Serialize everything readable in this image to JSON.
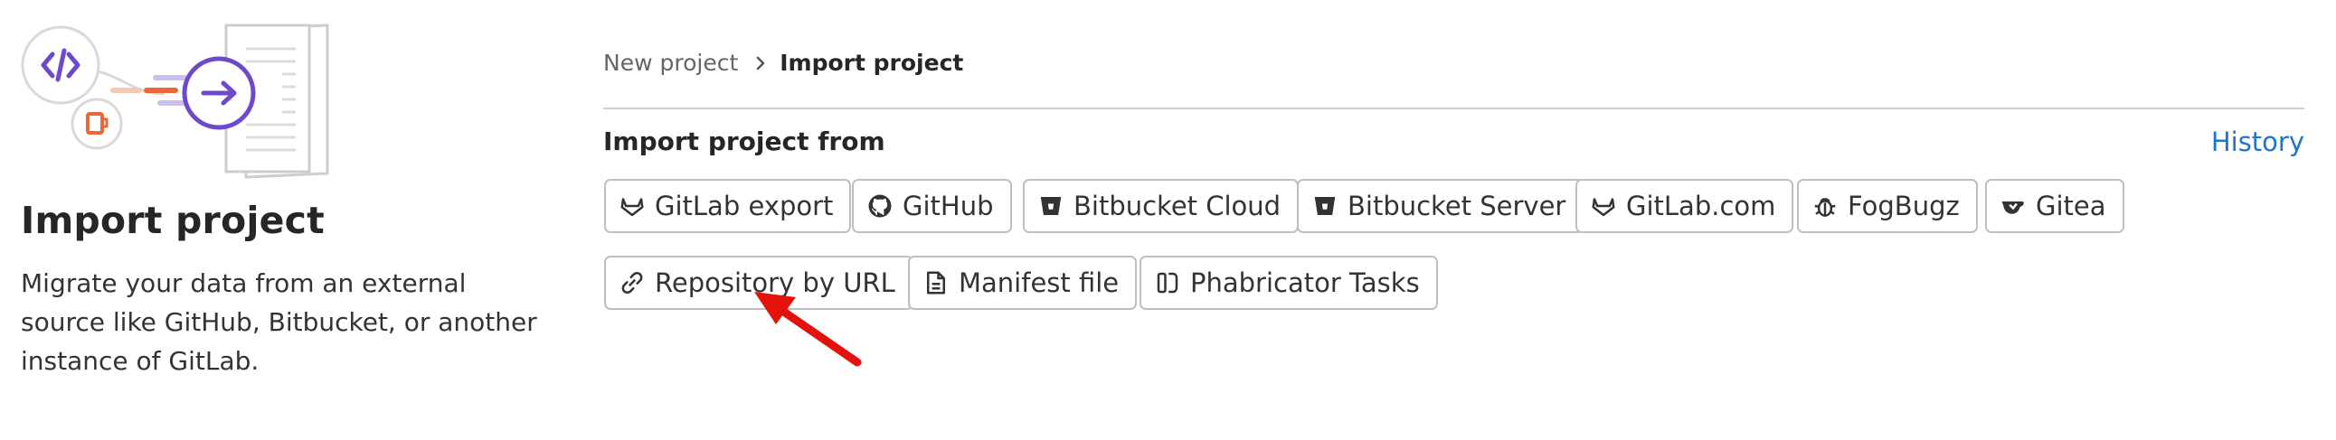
{
  "sidebar": {
    "title": "Import project",
    "description": "Migrate your data from an external source like GitHub, Bitbucket, or another instance of GitLab."
  },
  "breadcrumb": {
    "parent": "New project",
    "current": "Import project"
  },
  "main": {
    "heading": "Import project from",
    "history_link": "History",
    "sources": [
      {
        "label": "GitLab export",
        "icon": "tanuki-icon"
      },
      {
        "label": "GitHub",
        "icon": "github-icon"
      },
      {
        "label": "Bitbucket Cloud",
        "icon": "bitbucket-icon"
      },
      {
        "label": "Bitbucket Server",
        "icon": "bitbucket-icon"
      },
      {
        "label": "GitLab.com",
        "icon": "tanuki-icon"
      },
      {
        "label": "FogBugz",
        "icon": "bug-icon"
      },
      {
        "label": "Gitea",
        "icon": "tea-icon"
      },
      {
        "label": "Repository by URL",
        "icon": "link-icon"
      },
      {
        "label": "Manifest file",
        "icon": "document-icon"
      },
      {
        "label": "Phabricator Tasks",
        "icon": "phabricator-icon"
      }
    ]
  },
  "colors": {
    "accent": "#6e49cb",
    "orange": "#e9683a",
    "link": "#1f75cb",
    "annotation": "#e3120b"
  }
}
